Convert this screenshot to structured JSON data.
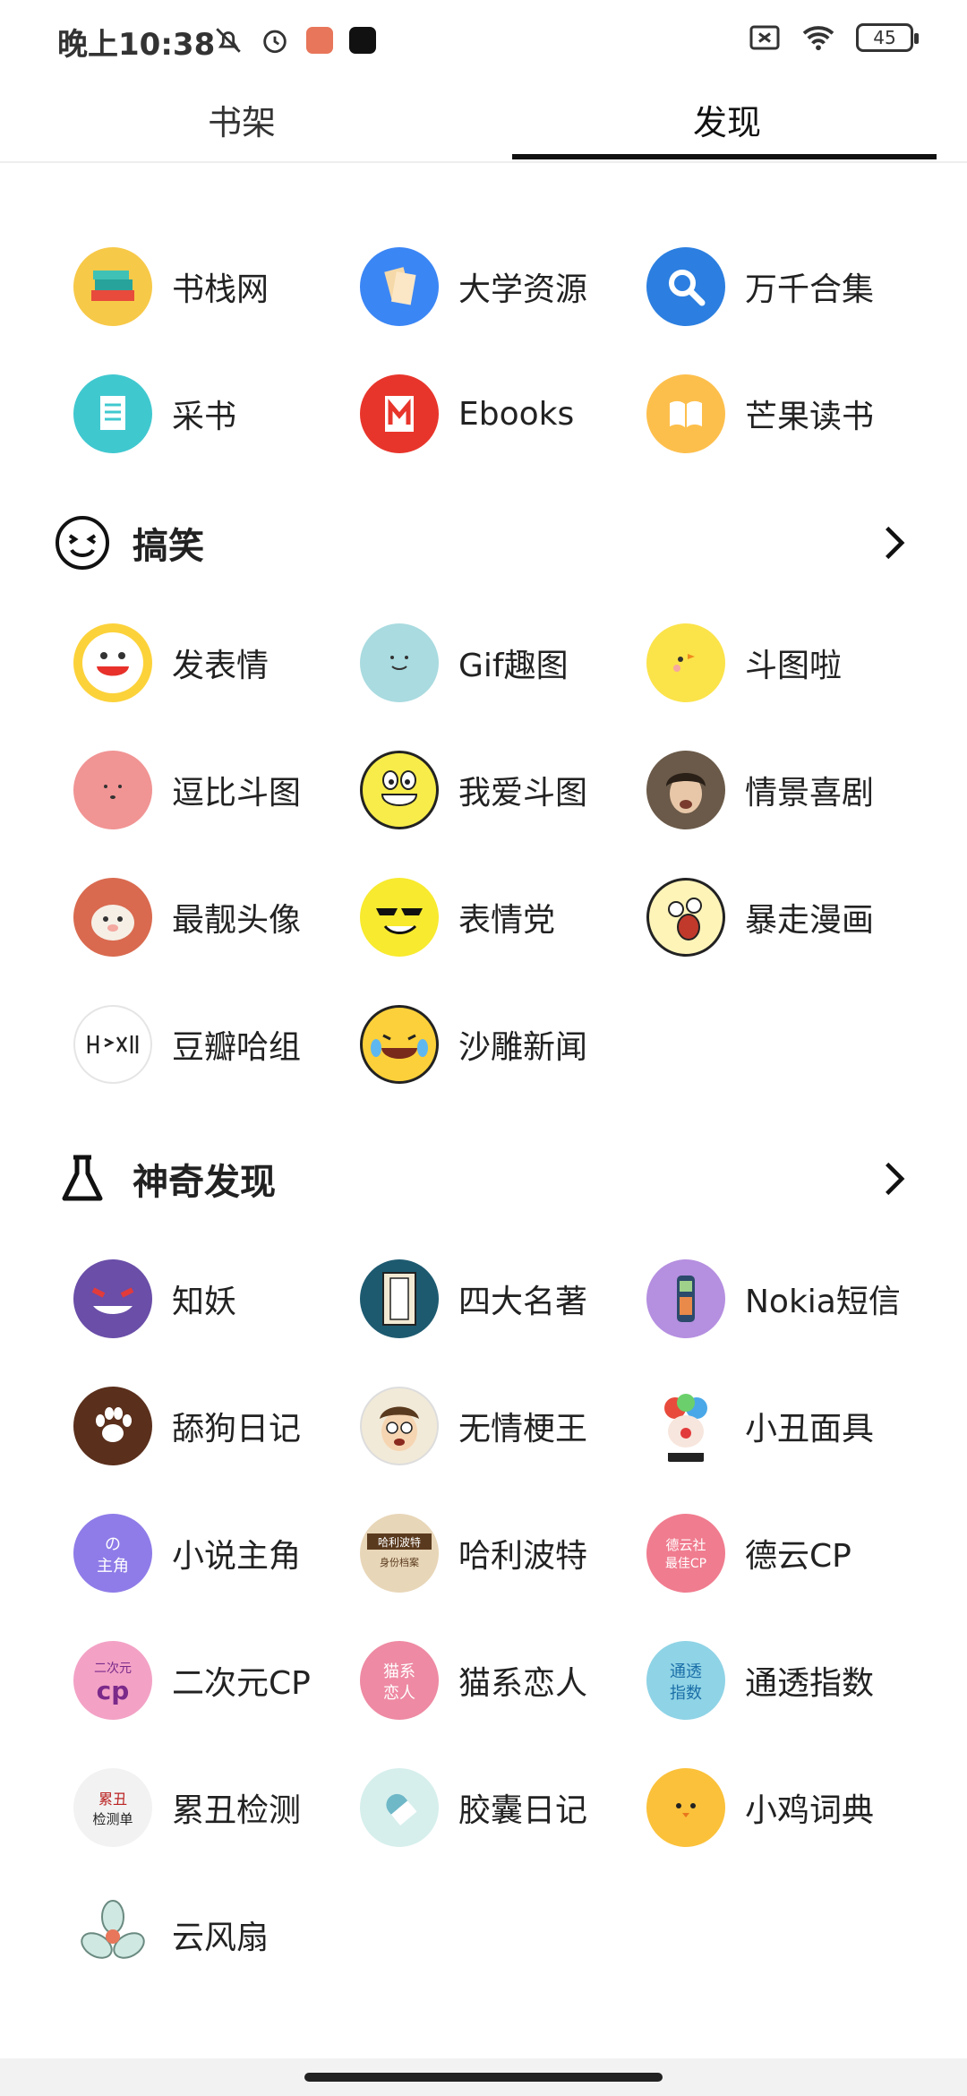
{
  "status_bar": {
    "time": "晚上10:38",
    "icons_left": [
      "bell-off-icon",
      "alarm-icon",
      "app-notification-icon",
      "capcut-icon"
    ],
    "icons_right": [
      "screen-cast-icon",
      "wifi-icon"
    ],
    "battery": "45"
  },
  "tabs": [
    {
      "label": "书架",
      "active": false
    },
    {
      "label": "发现",
      "active": true
    }
  ],
  "top_items": [
    {
      "label": "书栈网",
      "icon": "book-stack-icon",
      "color": "#f7c948"
    },
    {
      "label": "大学资源",
      "icon": "papers-icon",
      "color": "#3b86f5"
    },
    {
      "label": "万千合集",
      "icon": "magnifier-icon",
      "color": "#2c7fe0"
    },
    {
      "label": "采书",
      "icon": "document-icon",
      "color": "#40c8cf"
    },
    {
      "label": "Ebooks",
      "icon": "ebook-m-icon",
      "color": "#e8352b"
    },
    {
      "label": "芒果读书",
      "icon": "open-book-icon",
      "color": "#fdbf4c"
    }
  ],
  "section_funny": {
    "title": "搞笑",
    "icon": "smiley-face-icon",
    "items": [
      {
        "label": "发表情",
        "icon": "laughing-face-icon",
        "color": "#fcd23a"
      },
      {
        "label": "Gif趣图",
        "icon": "smile-face-icon",
        "color": "#a9dbe0"
      },
      {
        "label": "斗图啦",
        "icon": "chick-icon",
        "color": "#fbe34a"
      },
      {
        "label": "逗比斗图",
        "icon": "pink-face-icon",
        "color": "#f19494"
      },
      {
        "label": "我爱斗图",
        "icon": "grin-face-icon",
        "color": "#f7ec4a"
      },
      {
        "label": "情景喜剧",
        "icon": "sitcom-avatar-icon",
        "color": "#6b5a49"
      },
      {
        "label": "最靓头像",
        "icon": "cartoon-pig-icon",
        "color": "#d96a4f"
      },
      {
        "label": "表情党",
        "icon": "sunglasses-face-icon",
        "color": "#f8ea2e"
      },
      {
        "label": "暴走漫画",
        "icon": "rage-face-icon",
        "color": "#fff4b8"
      },
      {
        "label": "豆瓣哈组",
        "icon": "haha-text-icon",
        "color": "#ffffff"
      },
      {
        "label": "沙雕新闻",
        "icon": "tears-of-joy-icon",
        "color": "#fcd03a"
      }
    ]
  },
  "section_discover": {
    "title": "神奇发现",
    "icon": "flask-icon",
    "items": [
      {
        "label": "知妖",
        "icon": "ghost-monster-icon",
        "color": "#6a4ea8"
      },
      {
        "label": "四大名著",
        "icon": "classic-books-icon",
        "color": "#1d5a70"
      },
      {
        "label": "Nokia短信",
        "icon": "nokia-phone-icon",
        "color": "#b58fe0"
      },
      {
        "label": "舔狗日记",
        "icon": "paw-icon",
        "color": "#5a2f1c"
      },
      {
        "label": "无情梗王",
        "icon": "cartoon-boy-icon",
        "color": "#f2ead8"
      },
      {
        "label": "小丑面具",
        "icon": "clown-icon",
        "color": "#ffffff"
      },
      {
        "label": "小说主角",
        "icon": "novel-hero-icon",
        "color": "#8f7ce8",
        "badge_text": "の\n主角"
      },
      {
        "label": "哈利波特",
        "icon": "harry-potter-icon",
        "color": "#e8d6b8",
        "badge_text": "哈利波特\n身份档案"
      },
      {
        "label": "德云CP",
        "icon": "deyun-icon",
        "color": "#f07c8f",
        "badge_text": "德云社\n最佳CP"
      },
      {
        "label": "二次元CP",
        "icon": "anime-cp-icon",
        "color": "#f3a2c6",
        "badge_text": "二次元\ncp"
      },
      {
        "label": "猫系恋人",
        "icon": "cat-lover-icon",
        "color": "#ee8aa3",
        "badge_text": "猫系\n恋人"
      },
      {
        "label": "通透指数",
        "icon": "clarity-index-icon",
        "color": "#8fd3e6",
        "badge_text": "通透\n指数"
      },
      {
        "label": "累丑检测",
        "icon": "ugly-test-icon",
        "color": "#f2f2f2",
        "badge_text": "累丑\n检测单"
      },
      {
        "label": "胶囊日记",
        "icon": "capsule-icon",
        "color": "#d6efec"
      },
      {
        "label": "小鸡词典",
        "icon": "chick-face-icon",
        "color": "#fbc13a"
      },
      {
        "label": "云风扇",
        "icon": "fan-icon",
        "color": "#ffffff"
      }
    ]
  }
}
